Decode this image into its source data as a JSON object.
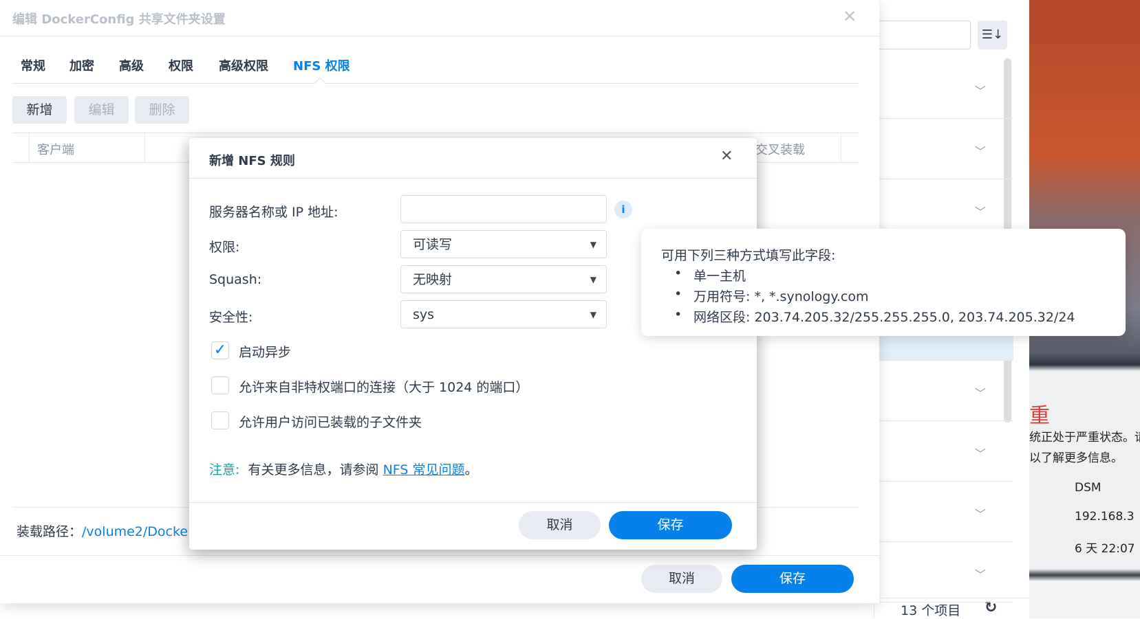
{
  "outer": {
    "title": "编辑 DockerConfig 共享文件夹设置",
    "tabs": [
      "常规",
      "加密",
      "高级",
      "权限",
      "高级权限",
      "NFS 权限"
    ],
    "toolbar": {
      "add": "新增",
      "edit": "编辑",
      "delete": "删除"
    },
    "columns": {
      "client": "客户端",
      "cross_mount": "交叉装载"
    },
    "mount_path_label": "装载路径：",
    "mount_path_value": "/volume2/Docke",
    "cancel": "取消",
    "save": "保存"
  },
  "behind": {
    "item_count": "13 个项目"
  },
  "widget": {
    "title_fragment": "重",
    "line1": "统正处于严重状态。请",
    "line2": "以了解更多信息。",
    "dsm": "DSM",
    "ip": "192.168.3",
    "uptime": "6 天 22:07"
  },
  "dialog": {
    "title": "新增 NFS 规则",
    "server_label": "服务器名称或 IP 地址:",
    "server_value": "",
    "permission_label": "权限:",
    "permission_value": "可读写",
    "squash_label": "Squash:",
    "squash_value": "无映射",
    "security_label": "安全性:",
    "security_value": "sys",
    "checkboxes": [
      {
        "label": "启动异步",
        "checked": true
      },
      {
        "label": "允许来自非特权端口的连接（大于 1024 的端口）",
        "checked": false
      },
      {
        "label": "允许用户访问已装载的子文件夹",
        "checked": false
      }
    ],
    "note_label": "注意:",
    "note_text": "有关更多信息，请参阅",
    "note_link": "NFS 常见问题",
    "note_end": "。",
    "cancel": "取消",
    "save": "保存"
  },
  "tooltip": {
    "heading": "可用下列三种方式填写此字段:",
    "items": [
      "单一主机",
      "万用符号:  *, *.synology.com",
      "网络区段:  203.74.205.32/255.255.255.0, 203.74.205.32/24"
    ]
  },
  "colors": {
    "accent": "#0781ea",
    "note": "#1aa3a3",
    "critical": "#e53935"
  }
}
